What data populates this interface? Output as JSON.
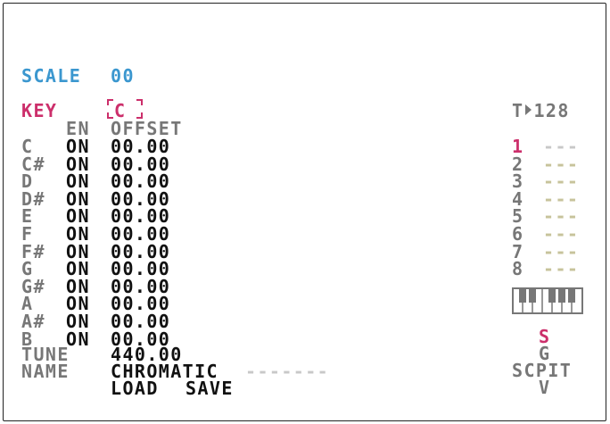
{
  "header": {
    "label": "SCALE",
    "value": "00"
  },
  "key": {
    "label": "KEY",
    "value": "C"
  },
  "columns": {
    "en": "EN",
    "offset": "OFFSET"
  },
  "rows": [
    {
      "note": "C",
      "en": "ON",
      "offset": "00.00"
    },
    {
      "note": "C#",
      "en": "ON",
      "offset": "00.00"
    },
    {
      "note": "D",
      "en": "ON",
      "offset": "00.00"
    },
    {
      "note": "D#",
      "en": "ON",
      "offset": "00.00"
    },
    {
      "note": "E",
      "en": "ON",
      "offset": "00.00"
    },
    {
      "note": "F",
      "en": "ON",
      "offset": "00.00"
    },
    {
      "note": "F#",
      "en": "ON",
      "offset": "00.00"
    },
    {
      "note": "G",
      "en": "ON",
      "offset": "00.00"
    },
    {
      "note": "G#",
      "en": "ON",
      "offset": "00.00"
    },
    {
      "note": "A",
      "en": "ON",
      "offset": "00.00"
    },
    {
      "note": "A#",
      "en": "ON",
      "offset": "00.00"
    },
    {
      "note": "B",
      "en": "ON",
      "offset": "00.00"
    }
  ],
  "tune": {
    "label": "TUNE",
    "value": "440.00"
  },
  "name": {
    "label": "NAME",
    "value": "CHROMATIC",
    "filler": "-------"
  },
  "actions": {
    "load": "LOAD",
    "save": "SAVE"
  },
  "tempo": {
    "prefix": "T",
    "value": "128"
  },
  "tracks": [
    {
      "num": "1",
      "dash": "---",
      "active": true
    },
    {
      "num": "2",
      "dash": "---",
      "active": false
    },
    {
      "num": "3",
      "dash": "---",
      "active": false
    },
    {
      "num": "4",
      "dash": "---",
      "active": false
    },
    {
      "num": "5",
      "dash": "---",
      "active": false
    },
    {
      "num": "6",
      "dash": "---",
      "active": false
    },
    {
      "num": "7",
      "dash": "---",
      "active": false
    },
    {
      "num": "8",
      "dash": "---",
      "active": false
    }
  ],
  "screen_indicator": {
    "s": "S",
    "g": "G",
    "word": "SCPIT",
    "v": "V"
  },
  "colors": {
    "blue": "#3b97cf",
    "pink": "#cc2f6b",
    "grey": "#777777",
    "light": "#c8c8c8"
  }
}
